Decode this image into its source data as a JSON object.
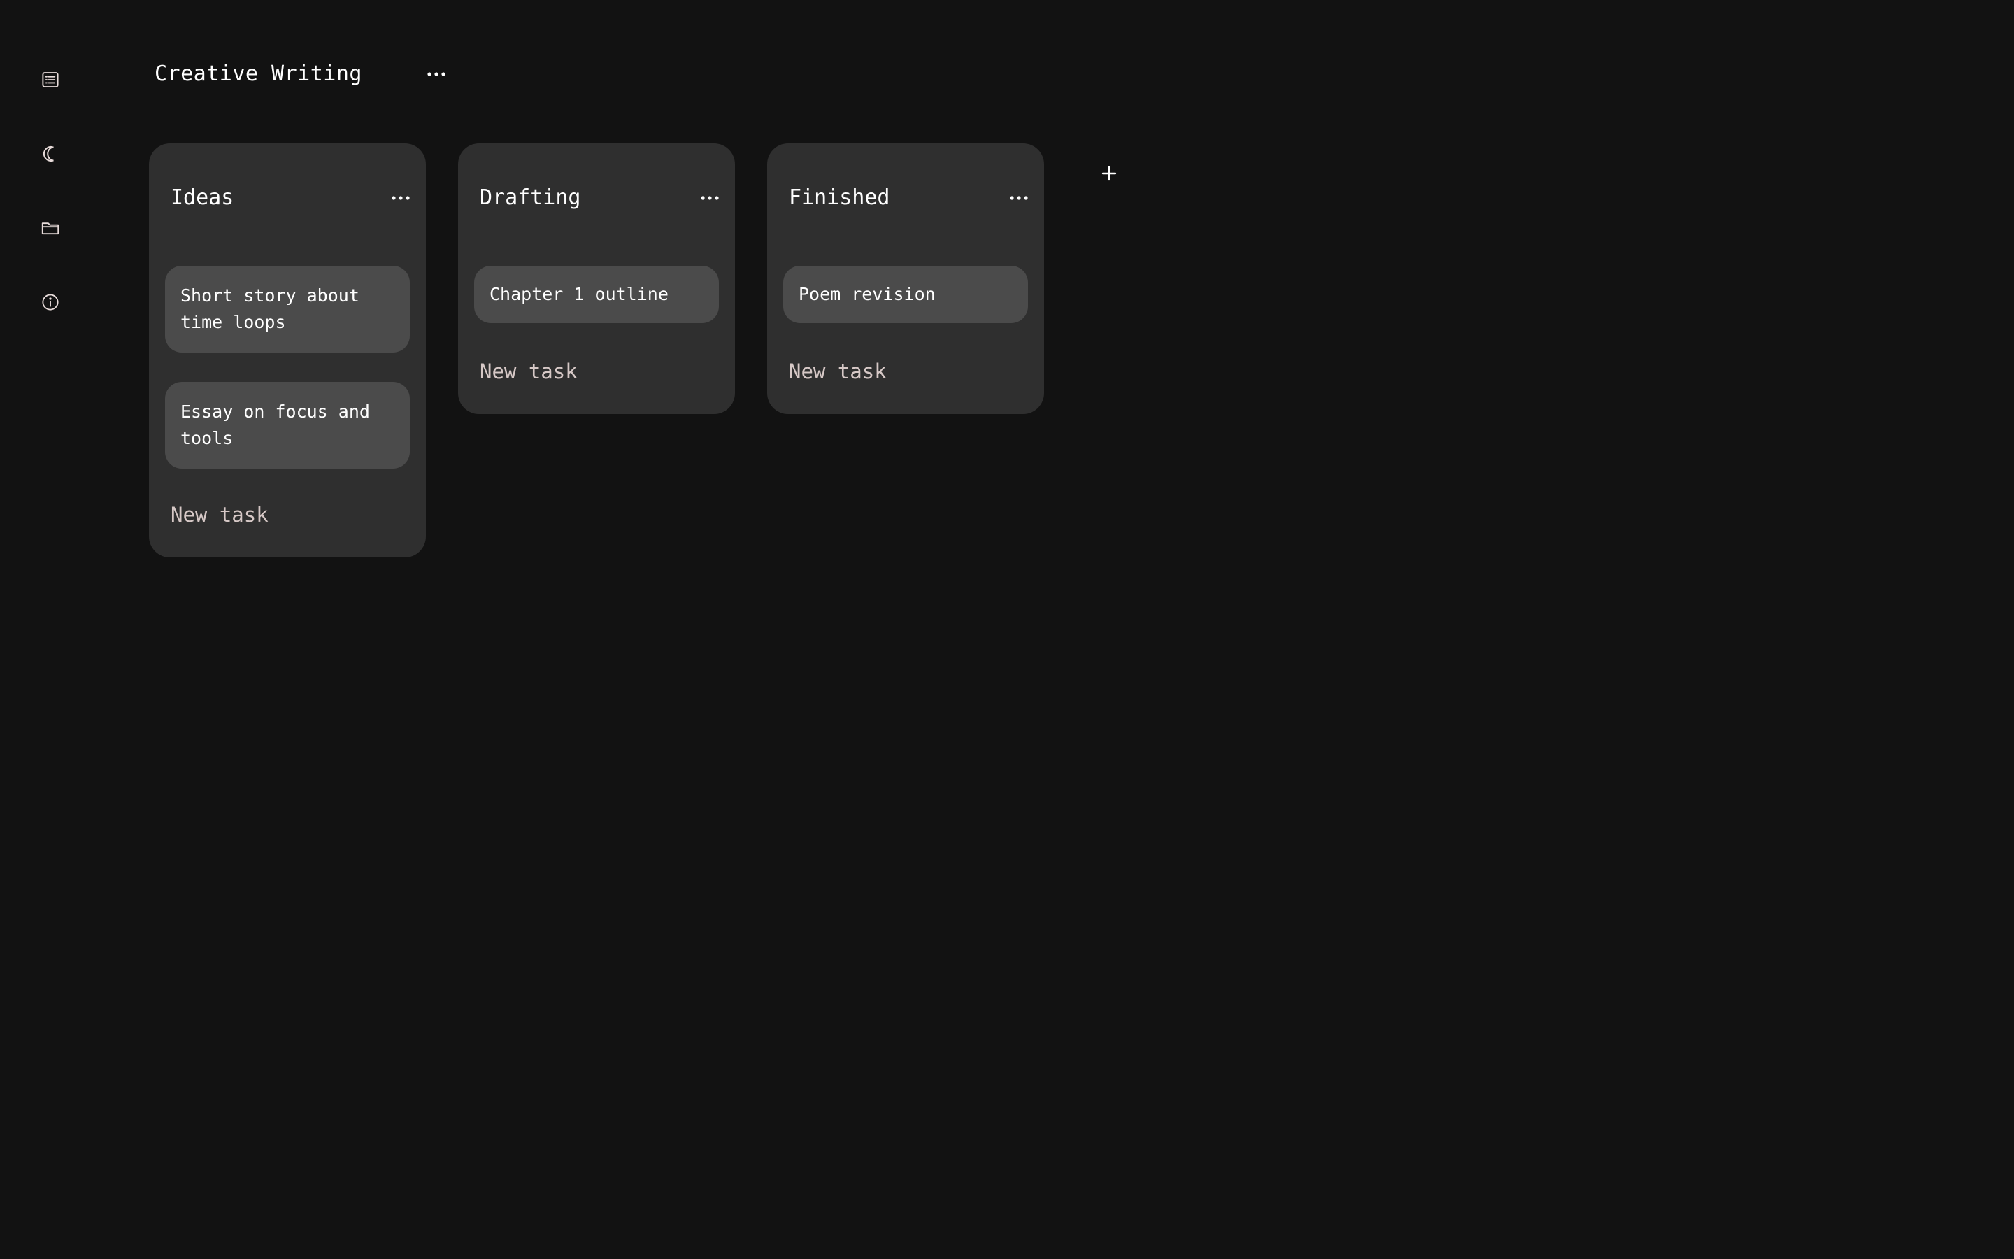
{
  "sidebar": {
    "items": [
      {
        "icon": "list-icon"
      },
      {
        "icon": "moon-icon"
      },
      {
        "icon": "folder-icon"
      },
      {
        "icon": "info-icon"
      }
    ]
  },
  "header": {
    "title": "Creative Writing",
    "menu_icon": "ellipsis-icon"
  },
  "columns": [
    {
      "title": "Ideas",
      "tasks": [
        "Short story about time loops",
        "Essay on focus and tools"
      ],
      "new_task_label": "New task"
    },
    {
      "title": "Drafting",
      "tasks": [
        "Chapter 1 outline"
      ],
      "new_task_label": "New task"
    },
    {
      "title": "Finished",
      "tasks": [
        "Poem revision"
      ],
      "new_task_label": "New task"
    }
  ],
  "add_column_icon": "plus-icon",
  "colors": {
    "background": "#121212",
    "column": "#2f2f2f",
    "card": "#4b4b4b",
    "text": "#ffffff",
    "muted_text": "#d6c8c6",
    "icon": "#e8dcda"
  }
}
